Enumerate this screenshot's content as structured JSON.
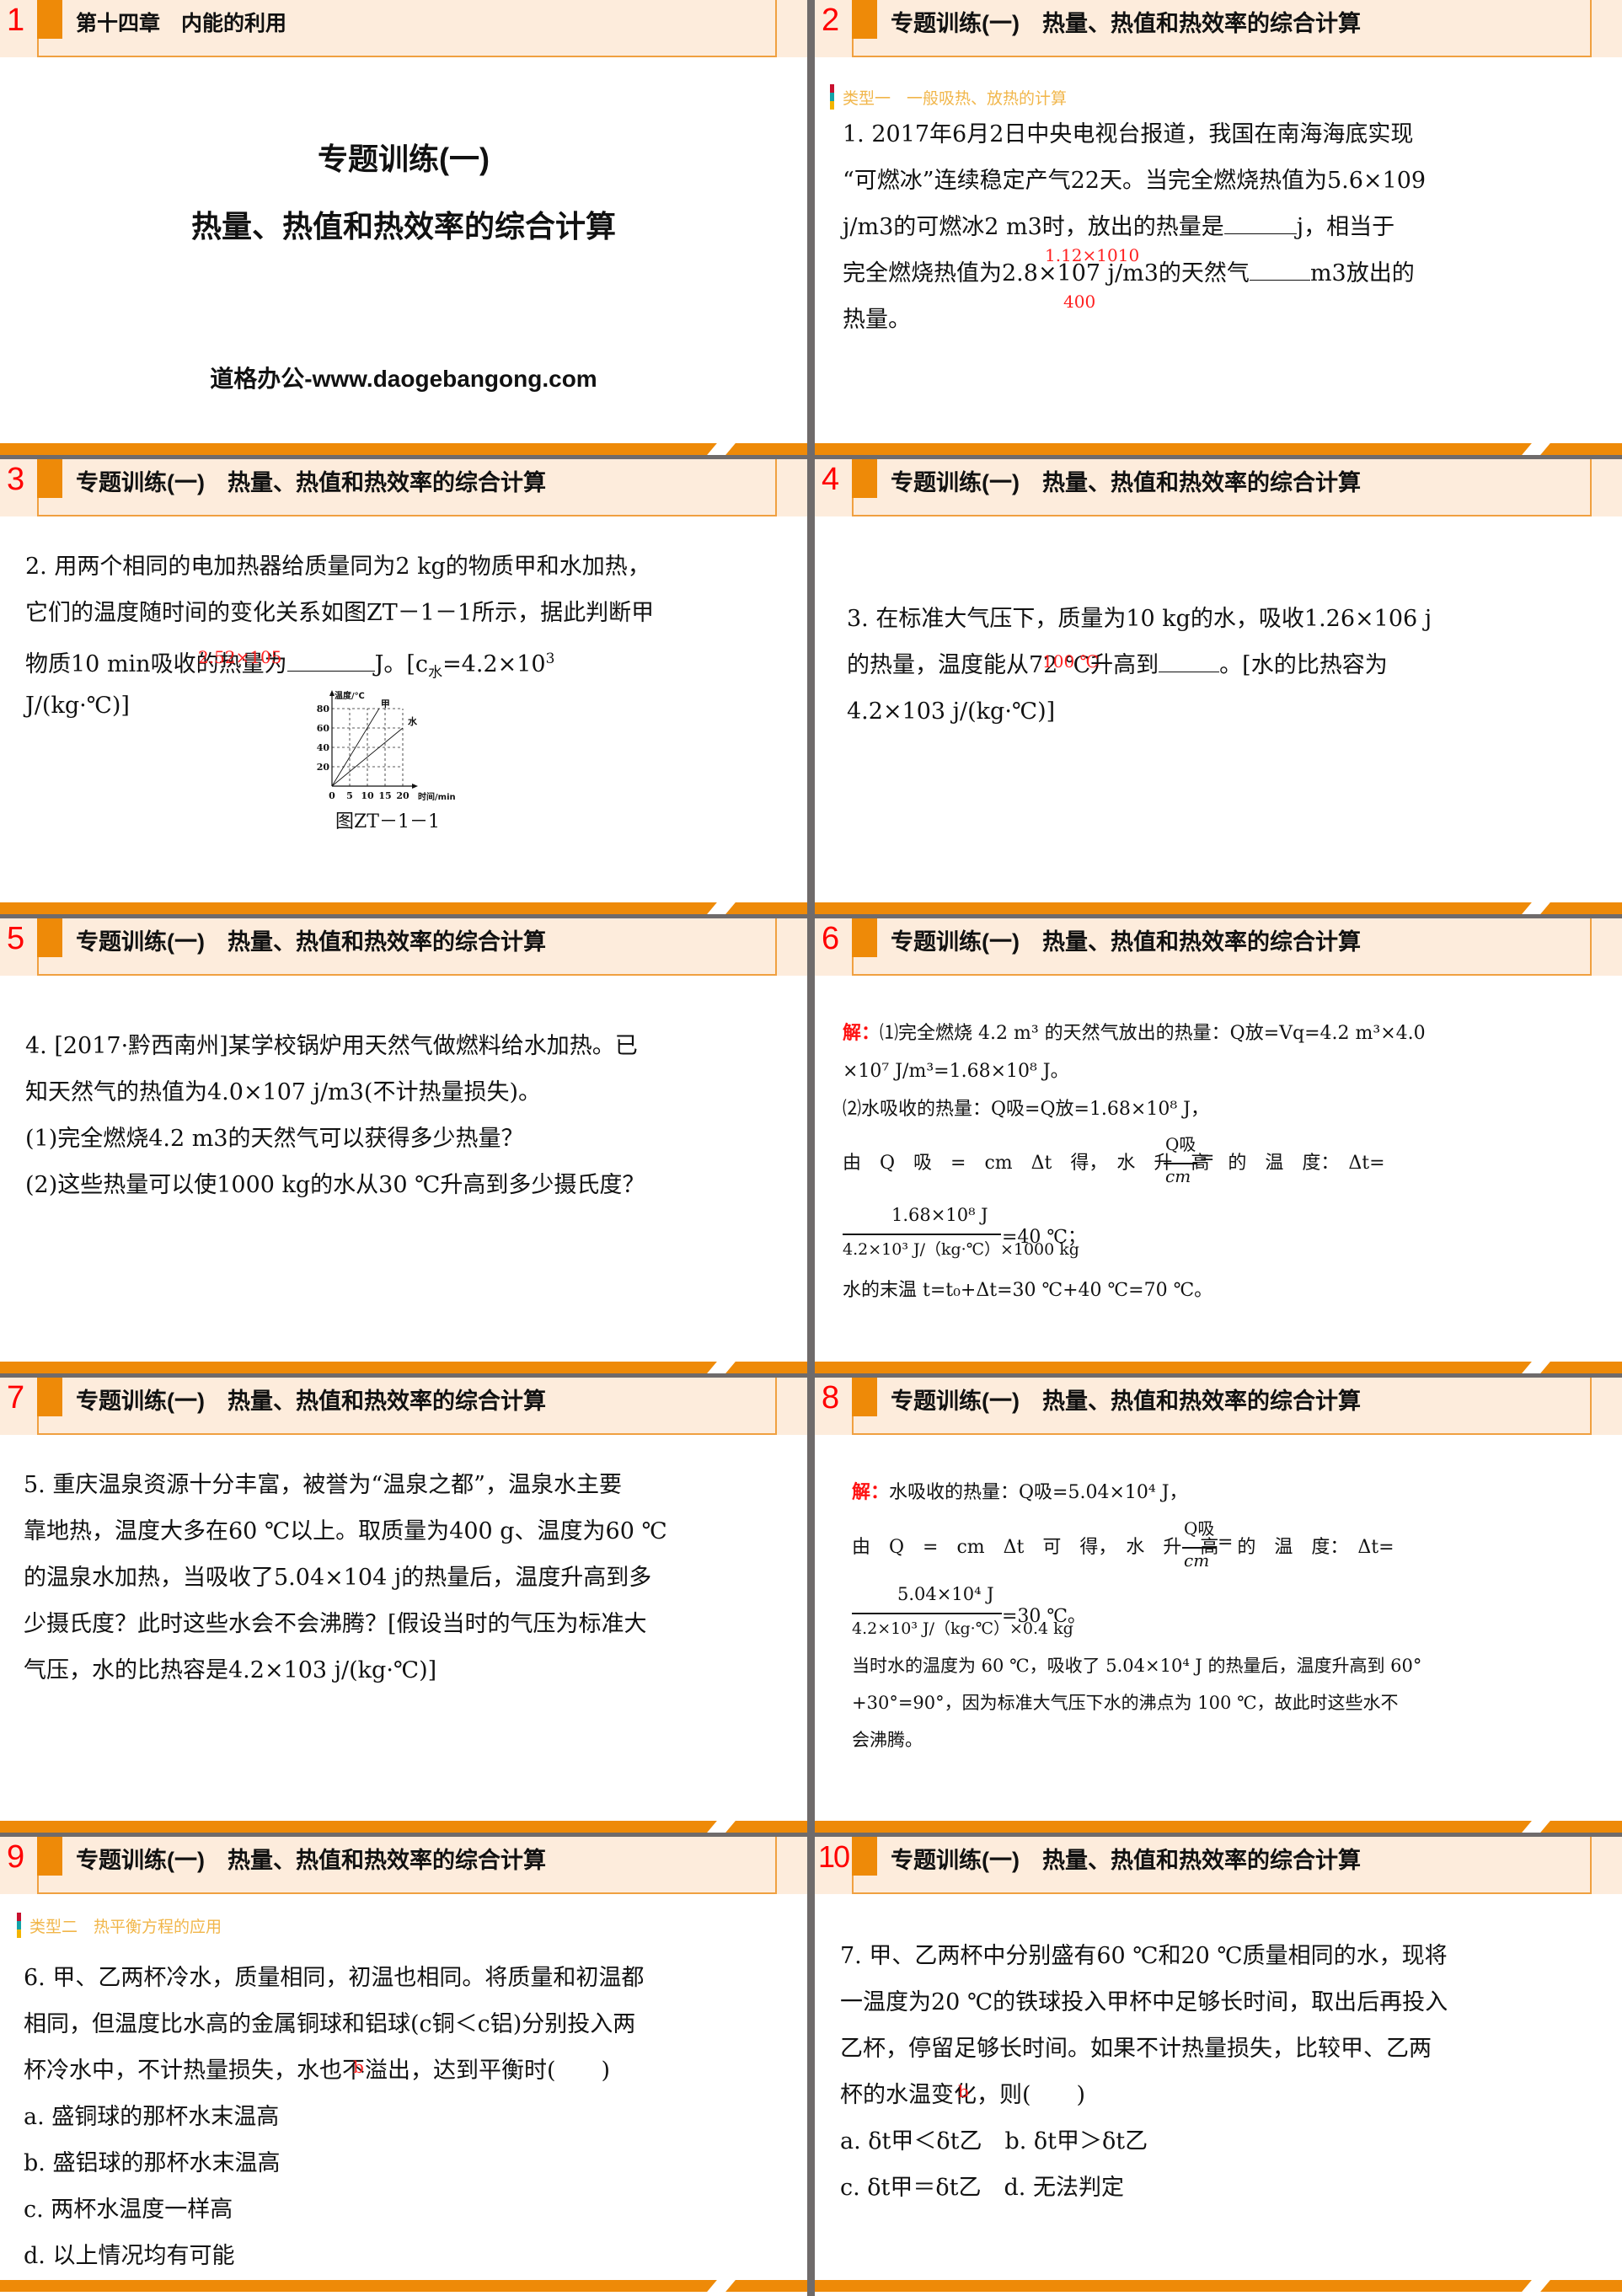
{
  "slides": [
    {
      "number": "1",
      "header_title": "第十四章　内能的利用",
      "cover_title_1": "专题训练(一)",
      "cover_title_2": "热量、热值和热效率的综合计算",
      "cover_site": "道格办公-www.daogebangong.com"
    },
    {
      "number": "2",
      "header_title": "专题训练(一)　热量、热值和热效率的综合计算",
      "category": "类型一　一般吸热、放热的计算",
      "lines": [
        "1. 2017年6月2日中央电视台报道，我国在南海海底实现",
        "“可燃冰”连续稳定产气22天。当完全燃烧热值为5.6×109",
        "j/m3的可燃冰2 m3时，放出的热量是",
        "j，相当于",
        "完全燃烧热值为2.8×107 j/m3的天然气",
        "m3放出的",
        "热量。"
      ],
      "answers": [
        "1.12×1010",
        "400"
      ]
    },
    {
      "number": "3",
      "header_title": "专题训练(一)　热量、热值和热效率的综合计算",
      "lines": [
        "2. 用两个相同的电加热器给质量同为2 kg的物质甲和水加热，",
        "它们的温度随时间的变化关系如图ZT－1－1所示，据此判断甲",
        "物质10 min吸收的热量为",
        "J。[c",
        "水",
        "=4.2×10",
        "3",
        "J/(kg·℃)]"
      ],
      "answers": [
        "2.52×105"
      ],
      "figure_caption": "图ZT－1－1",
      "chart_data": {
        "type": "line",
        "title": "",
        "xlabel": "时间/min",
        "ylabel": "温度/℃",
        "x_ticks": [
          "0",
          "5",
          "10",
          "15",
          "20"
        ],
        "y_ticks": [
          "20",
          "40",
          "60",
          "80"
        ],
        "xlim": [
          0,
          20
        ],
        "ylim": [
          0,
          80
        ],
        "grid": "dashed",
        "series": [
          {
            "name": "甲",
            "points": [
              [
                0,
                0
              ],
              [
                13.3,
                80
              ]
            ]
          },
          {
            "name": "水",
            "points": [
              [
                0,
                0
              ],
              [
                20,
                60
              ]
            ]
          }
        ]
      }
    },
    {
      "number": "4",
      "header_title": "专题训练(一)　热量、热值和热效率的综合计算",
      "lines": [
        "3. 在标准大气压下，质量为10 kg的水，吸收1.26×106 j",
        "的热量，温度能从72 ℃升高到",
        "。[水的比热容为",
        "4.2×103 j/(kg·℃)]"
      ],
      "answers": [
        "100 ℃"
      ]
    },
    {
      "number": "5",
      "header_title": "专题训练(一)　热量、热值和热效率的综合计算",
      "lines": [
        "4. [2017·黔西南州]某学校锅炉用天然气做燃料给水加热。已",
        "知天然气的热值为4.0×107 j/m3(不计热量损失)。",
        "(1)完全燃烧4.2 m3的天然气可以获得多少热量？",
        "(2)这些热量可以使1000 kg的水从30 ℃升高到多少摄氏度？"
      ]
    },
    {
      "number": "6",
      "header_title": "专题训练(一)　热量、热值和热效率的综合计算",
      "solution_label": "解：",
      "lines": [
        "⑴完全燃烧 4.2 m³ 的天然气放出的热量：Q放=Vq=4.2 m³×4.0",
        "×10⁷ J/m³=1.68×10⁸ J。",
        "⑵水吸收的热量：Q吸=Q放=1.68×10⁸ J，",
        "由　Q　吸　=　cm　Δt　得，　水　升　高　的　温　度：　Δt=",
        "=",
        "=40 ℃；",
        "水的末温 t=t₀+Δt=30 ℃+40 ℃=70 ℃。"
      ],
      "fraction_1": {
        "numerator": "Q吸",
        "denominator": "cm"
      },
      "fraction_2": {
        "numerator": "1.68×10⁸ J",
        "denominator": "4.2×10³ J/（kg·℃）×1000 kg"
      }
    },
    {
      "number": "7",
      "header_title": "专题训练(一)　热量、热值和热效率的综合计算",
      "lines": [
        "5. 重庆温泉资源十分丰富，被誉为“温泉之都”，温泉水主要",
        "靠地热，温度大多在60 ℃以上。取质量为400 g、温度为60 ℃",
        "的温泉水加热，当吸收了5.04×104 j的热量后，温度升高到多",
        "少摄氏度？此时这些水会不会沸腾？[假设当时的气压为标准大",
        "气压，水的比热容是4.2×103 j/(kg·℃)]"
      ]
    },
    {
      "number": "8",
      "header_title": "专题训练(一)　热量、热值和热效率的综合计算",
      "solution_label": "解：",
      "lines": [
        "水吸收的热量：Q吸=5.04×10⁴ J，",
        "由　Q　=　cm　Δt　可　得，　水　升　高　的　温　度：　Δt=",
        "=",
        "=30 ℃。",
        "当时水的温度为 60 ℃，吸收了 5.04×10⁴ J 的热量后，温度升高到 60°",
        "+30°=90°，因为标准大气压下水的沸点为 100 ℃，故此时这些水不",
        "会沸腾。"
      ],
      "fraction_1": {
        "numerator": "Q吸",
        "denominator": "cm"
      },
      "fraction_2": {
        "numerator": "5.04×10⁴ J",
        "denominator": "4.2×10³ J/（kg·℃）×0.4 kg"
      }
    },
    {
      "number": "9",
      "header_title": "专题训练(一)　热量、热值和热效率的综合计算",
      "category": "类型二　热平衡方程的应用",
      "lines": [
        "6. 甲、乙两杯冷水，质量相同，初温也相同。将质量和初温都",
        "相同，但温度比水高的金属铜球和铝球(c铜＜c铝)分别投入两",
        "杯冷水中，不计热量损失，水也不溢出，达到平衡时(　　)"
      ],
      "answers": [
        "b"
      ],
      "options": [
        "a. 盛铜球的那杯水末温高",
        "b. 盛铝球的那杯水末温高",
        "c. 两杯水温度一样高",
        "d. 以上情况均有可能"
      ]
    },
    {
      "number": "10",
      "header_title": "专题训练(一)　热量、热值和热效率的综合计算",
      "lines": [
        "7. 甲、乙两杯中分别盛有60 ℃和20 ℃质量相同的水，现将",
        "一温度为20 ℃的铁球投入甲杯中足够长时间，取出后再投入",
        "乙杯，停留足够长时间。如果不计热量损失，比较甲、乙两",
        "杯的水温变化，则(　　)"
      ],
      "answers": [
        "b"
      ],
      "options": [
        "a. δt甲＜δt乙　b. δt甲＞δt乙",
        "c. δt甲＝δt乙　d. 无法判定"
      ]
    }
  ],
  "colors": {
    "accent_orange": "#ee8a08",
    "header_bg": "#fdecdc",
    "slide_number": "#ff0000",
    "answer_red": "#ff2020",
    "category_text": "#f1b64a",
    "separator_gray": "#6f6b6b"
  }
}
